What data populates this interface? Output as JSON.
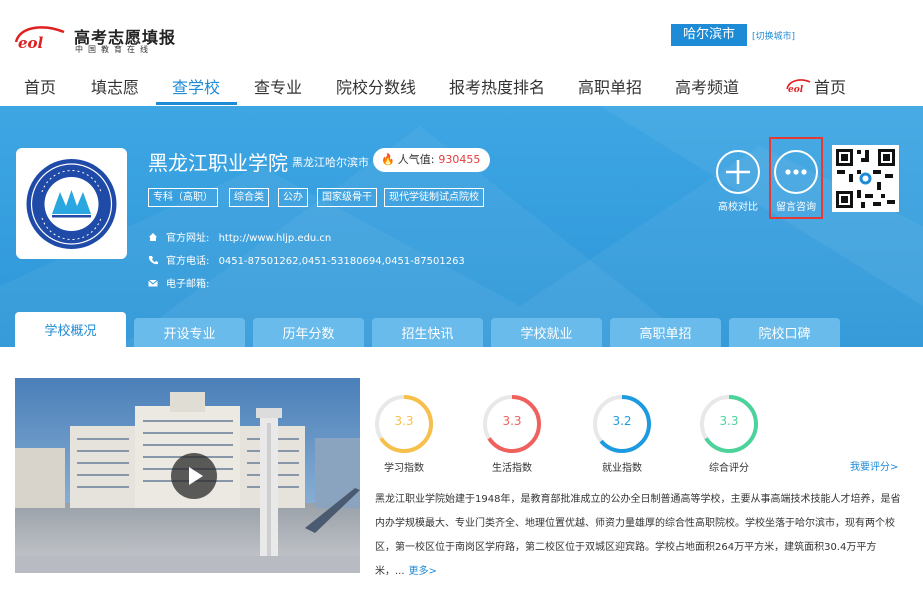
{
  "header": {
    "logo_brand": "eol",
    "logo_title": "高考志愿填报",
    "logo_subtitle": "中国教育在线",
    "city": "哈尔滨市",
    "city_switch": "[切换城市]"
  },
  "nav": {
    "items": [
      "首页",
      "填志愿",
      "查学校",
      "查专业",
      "院校分数线",
      "报考热度排名",
      "高职单招",
      "高考频道"
    ],
    "active": "查学校",
    "eol_home_brand": "eol",
    "eol_home": "首页"
  },
  "school": {
    "name": "黑龙江职业学院",
    "location": "黑龙江哈尔滨市",
    "popularity_label": "人气值:",
    "popularity_value": "930455",
    "tags": [
      "专科（高职）",
      "综合类",
      "公办",
      "国家级骨干",
      "现代学徒制试点院校"
    ],
    "website_label": "官方网址:",
    "website": "http://www.hljp.edu.cn",
    "phone_label": "官方电话:",
    "phone": "0451-87501262,0451-53180694,0451-87501263",
    "email_label": "电子邮箱:",
    "email": ""
  },
  "actions": {
    "compare": "高校对比",
    "consult": "留言咨询"
  },
  "tabs": [
    "学校概况",
    "开设专业",
    "历年分数",
    "招生快讯",
    "学校就业",
    "高职单招",
    "院校口碑"
  ],
  "ratings": [
    {
      "label": "学习指数",
      "value": "3.3",
      "fraction": 0.66,
      "color": "#f6c04a"
    },
    {
      "label": "生活指数",
      "value": "3.3",
      "fraction": 0.66,
      "color": "#f0605c"
    },
    {
      "label": "就业指数",
      "value": "3.2",
      "fraction": 0.64,
      "color": "#1e9be0"
    },
    {
      "label": "综合评分",
      "value": "3.3",
      "fraction": 0.66,
      "color": "#4cd39b"
    }
  ],
  "rate_link": "我要评分>",
  "description": "黑龙江职业学院始建于1948年，是教育部批准成立的公办全日制普通高等学校，主要从事高端技术技能人才培养，是省内办学规模最大、专业门类齐全、地理位置优越、师资力量雄厚的综合性高职院校。学校坐落于哈尔滨市，现有两个校区，第一校区位于南岗区学府路，第二校区位于双城区迎宾路。学校占地面积264万平方米，建筑面积30.4万平方米，...",
  "more": "更多>"
}
